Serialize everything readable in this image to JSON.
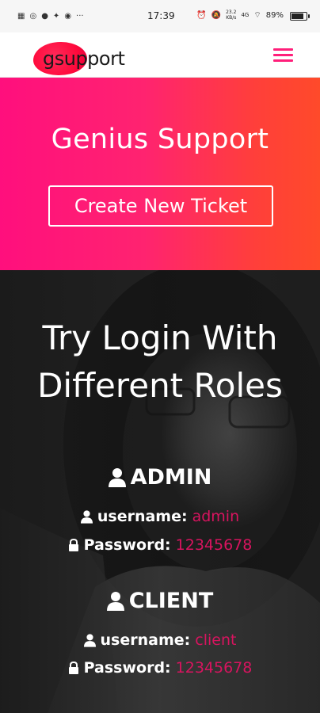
{
  "status_bar": {
    "time": "17:39",
    "battery": "89%",
    "speed": "23.2",
    "speed_unit": "KB/s",
    "network": "4G",
    "left_icons": [
      "grid-icon",
      "whatsapp-icon",
      "message-icon",
      "twitter-icon",
      "location-icon",
      "more-icon"
    ]
  },
  "navbar": {
    "logo_text": "gsupport",
    "menu_icon": "hamburger-icon",
    "accent_color": "#ff1f7a"
  },
  "hero": {
    "title": "Genius Support",
    "button_label": "Create New Ticket",
    "gradient": [
      "#ff0f7d",
      "#ff4a2a"
    ]
  },
  "roles": {
    "title_line1": "Try Login With",
    "title_line2": "Different Roles",
    "items": [
      {
        "role": "ADMIN",
        "username_label": "username:",
        "username_value": "admin",
        "password_label": "Password:",
        "password_value": "12345678"
      },
      {
        "role": "CLIENT",
        "username_label": "username:",
        "username_value": "client",
        "password_label": "Password:",
        "password_value": "12345678"
      }
    ],
    "value_color": "#d8145f"
  }
}
